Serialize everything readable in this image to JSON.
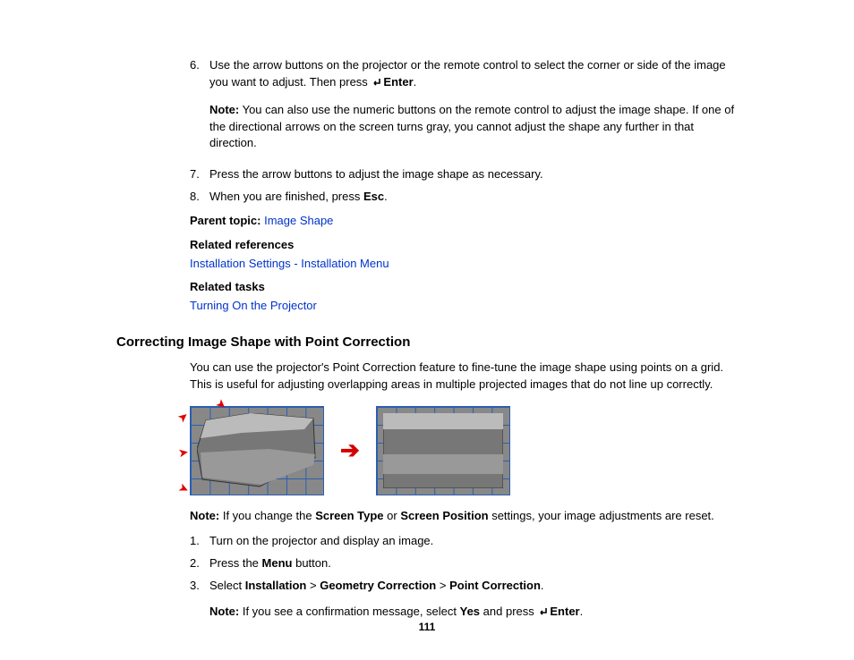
{
  "steps_top": [
    {
      "num": "6.",
      "body_pre": "Use the arrow buttons on the projector or the remote control to select the corner or side of the image you want to adjust. Then press ",
      "enter": "Enter",
      "period": ".",
      "note_label": "Note:",
      "note_body": " You can also use the numeric buttons on the remote control to adjust the image shape. If one of the directional arrows on the screen turns gray, you cannot adjust the shape any further in that direction."
    },
    {
      "num": "7.",
      "body": "Press the arrow buttons to adjust the image shape as necessary."
    },
    {
      "num": "8.",
      "body_pre": "When you are finished, press ",
      "bold": "Esc",
      "period": "."
    }
  ],
  "parent_topic_label": "Parent topic: ",
  "parent_topic_link": "Image Shape",
  "related_refs_label": "Related references",
  "related_refs_link": "Installation Settings - Installation Menu",
  "related_tasks_label": "Related tasks",
  "related_tasks_link": "Turning On the Projector",
  "heading": "Correcting Image Shape with Point Correction",
  "intro": "You can use the projector's Point Correction feature to fine-tune the image shape using points on a grid. This is useful for adjusting overlapping areas in multiple projected images that do not line up correctly.",
  "mid_note_label": "Note:",
  "mid_note_pre": " If you change the ",
  "mid_note_b1": "Screen Type",
  "mid_note_mid": " or ",
  "mid_note_b2": "Screen Position",
  "mid_note_post": " settings, your image adjustments are reset.",
  "steps_bottom": [
    {
      "num": "1.",
      "body": "Turn on the projector and display an image."
    },
    {
      "num": "2.",
      "pre": "Press the ",
      "b": "Menu",
      "post": " button."
    },
    {
      "num": "3.",
      "pre": "Select ",
      "b1": "Installation",
      "sep1": " > ",
      "b2": "Geometry Correction",
      "sep2": " > ",
      "b3": "Point Correction",
      "post": ".",
      "note_label": "Note:",
      "note_pre": " If you see a confirmation message, select ",
      "nb1": "Yes",
      "note_mid": " and press ",
      "nb2": "Enter",
      "note_post": "."
    }
  ],
  "page_number": "111"
}
